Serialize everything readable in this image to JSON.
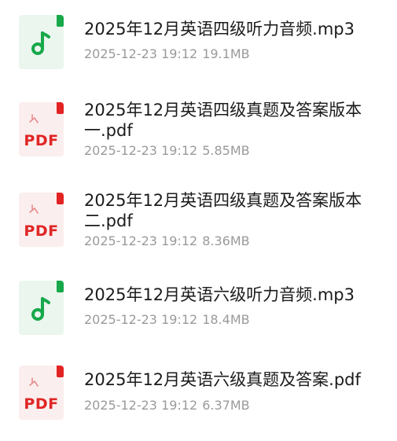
{
  "files": [
    {
      "icon": "audio-file-icon",
      "name": "2025年12月英语四级听力音频.mp3",
      "date": "2025-12-23 19:12",
      "size": "19.1MB"
    },
    {
      "icon": "pdf-file-icon",
      "icon_label": "PDF",
      "name": "2025年12月英语四级真题及答案版本一.pdf",
      "date": "2025-12-23 19:12",
      "size": "5.85MB"
    },
    {
      "icon": "pdf-file-icon",
      "icon_label": "PDF",
      "name": "2025年12月英语四级真题及答案版本二.pdf",
      "date": "2025-12-23 19:12",
      "size": "8.36MB"
    },
    {
      "icon": "audio-file-icon",
      "name": "2025年12月英语六级听力音频.mp3",
      "date": "2025-12-23 19:12",
      "size": "18.4MB"
    },
    {
      "icon": "pdf-file-icon",
      "icon_label": "PDF",
      "name": "2025年12月英语六级真题及答案.pdf",
      "date": "2025-12-23 19:12",
      "size": "6.37MB"
    }
  ],
  "colors": {
    "audio_accent": "#17a84a",
    "pdf_accent": "#e22323"
  }
}
